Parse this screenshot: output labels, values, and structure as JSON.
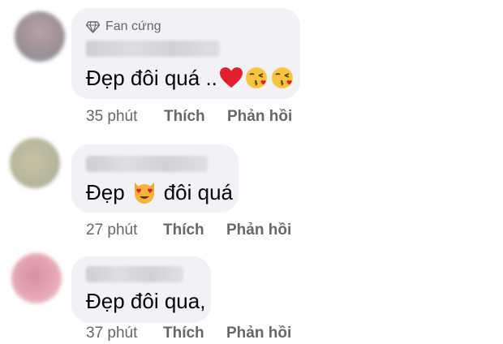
{
  "comments": [
    {
      "badge": "Fan cứng",
      "badge_icon": "diamond-icon",
      "text": "Đẹp đôi quá ..",
      "emojis": [
        "red-heart-icon",
        "kissing-face-icon",
        "kissing-face-icon"
      ],
      "time": "35 phút",
      "like_label": "Thích",
      "reply_label": "Phản hồi"
    },
    {
      "text_before": "Đẹp",
      "emoji": "heart-eyes-cat-icon",
      "text_after": "đôi quá",
      "time": "27 phút",
      "like_label": "Thích",
      "reply_label": "Phản hồi"
    },
    {
      "text": "Đẹp đôi qua,",
      "time": "37 phút",
      "like_label": "Thích",
      "reply_label": "Phản hồi"
    }
  ],
  "colors": {
    "bubble": "#f0f2f5",
    "meta_text": "#65676b",
    "body_text": "#050505"
  }
}
